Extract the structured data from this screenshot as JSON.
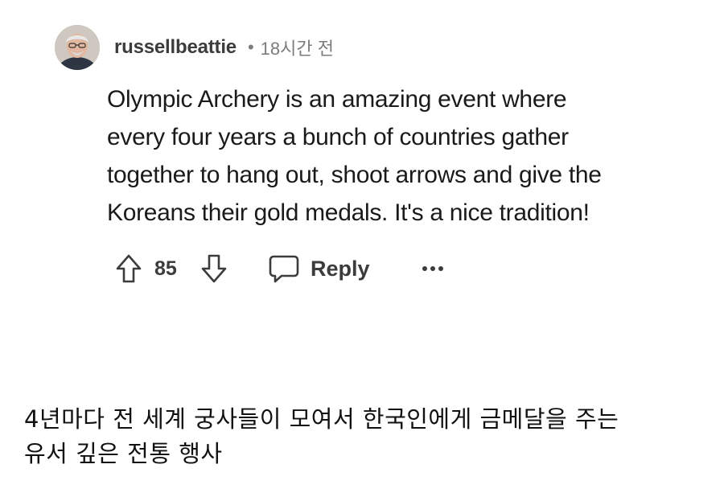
{
  "comment": {
    "author": {
      "username": "russellbeattie",
      "avatar_icon": "user-avatar-photo"
    },
    "separator": "•",
    "timestamp": "18시간 전",
    "body_lines": [
      "Olympic Archery is an amazing event where",
      "every four years a bunch of countries gather",
      "together to hang out, shoot arrows and give the",
      "Koreans their gold medals. It's a nice tradition!"
    ],
    "actions": {
      "upvote_icon": "arrow-up-icon",
      "score": "85",
      "downvote_icon": "arrow-down-icon",
      "reply_icon": "speech-bubble-icon",
      "reply_label": "Reply",
      "more_icon": "more-options-icon",
      "more_label": "•••"
    }
  },
  "caption": {
    "lines": [
      "4년마다 전 세계 궁사들이 모여서 한국인에게 금메달을 주는",
      "유서 깊은 전통 행사"
    ]
  },
  "colors": {
    "text_primary": "#1a1a1b",
    "text_secondary": "#7c7c7c",
    "icon": "#3c3c3c",
    "background": "#ffffff"
  }
}
